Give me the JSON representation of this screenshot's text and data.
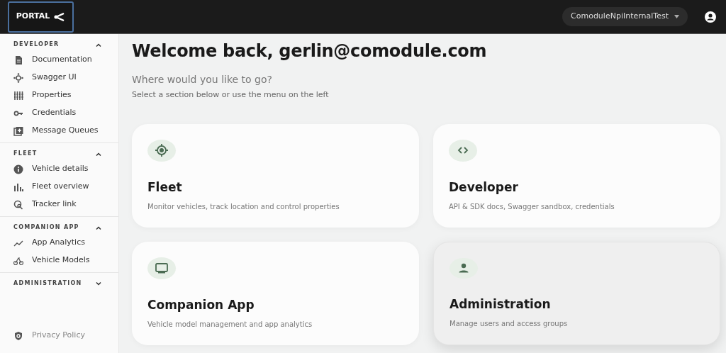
{
  "topbar": {
    "logo": "PORTAL",
    "organization": "ComoduleNpiInternalTest"
  },
  "sidebar": {
    "sections": [
      {
        "title": "DEVELOPER",
        "expanded": true,
        "items": [
          {
            "label": "Documentation"
          },
          {
            "label": "Swagger UI"
          },
          {
            "label": "Properties"
          },
          {
            "label": "Credentials"
          },
          {
            "label": "Message Queues"
          }
        ]
      },
      {
        "title": "FLEET",
        "expanded": true,
        "items": [
          {
            "label": "Vehicle details"
          },
          {
            "label": "Fleet overview"
          },
          {
            "label": "Tracker link"
          }
        ]
      },
      {
        "title": "COMPANION APP",
        "expanded": true,
        "items": [
          {
            "label": "App Analytics"
          },
          {
            "label": "Vehicle Models"
          }
        ]
      },
      {
        "title": "ADMINISTRATION",
        "expanded": false
      }
    ],
    "footer_link": "Privacy Policy"
  },
  "main": {
    "title": "Welcome back, gerlin@comodule.com",
    "subtitle": "Where would you like to go?",
    "hint": "Select a section below or use the menu on the left",
    "cards": [
      {
        "title": "Fleet",
        "description": "Monitor vehicles, track location and control properties",
        "hovered": false
      },
      {
        "title": "Developer",
        "description": "API & SDK docs, Swagger sandbox, credentials",
        "hovered": false
      },
      {
        "title": "Companion App",
        "description": "Vehicle model management and app analytics",
        "hovered": false
      },
      {
        "title": "Administration",
        "description": "Manage users and access groups",
        "hovered": true
      }
    ]
  }
}
